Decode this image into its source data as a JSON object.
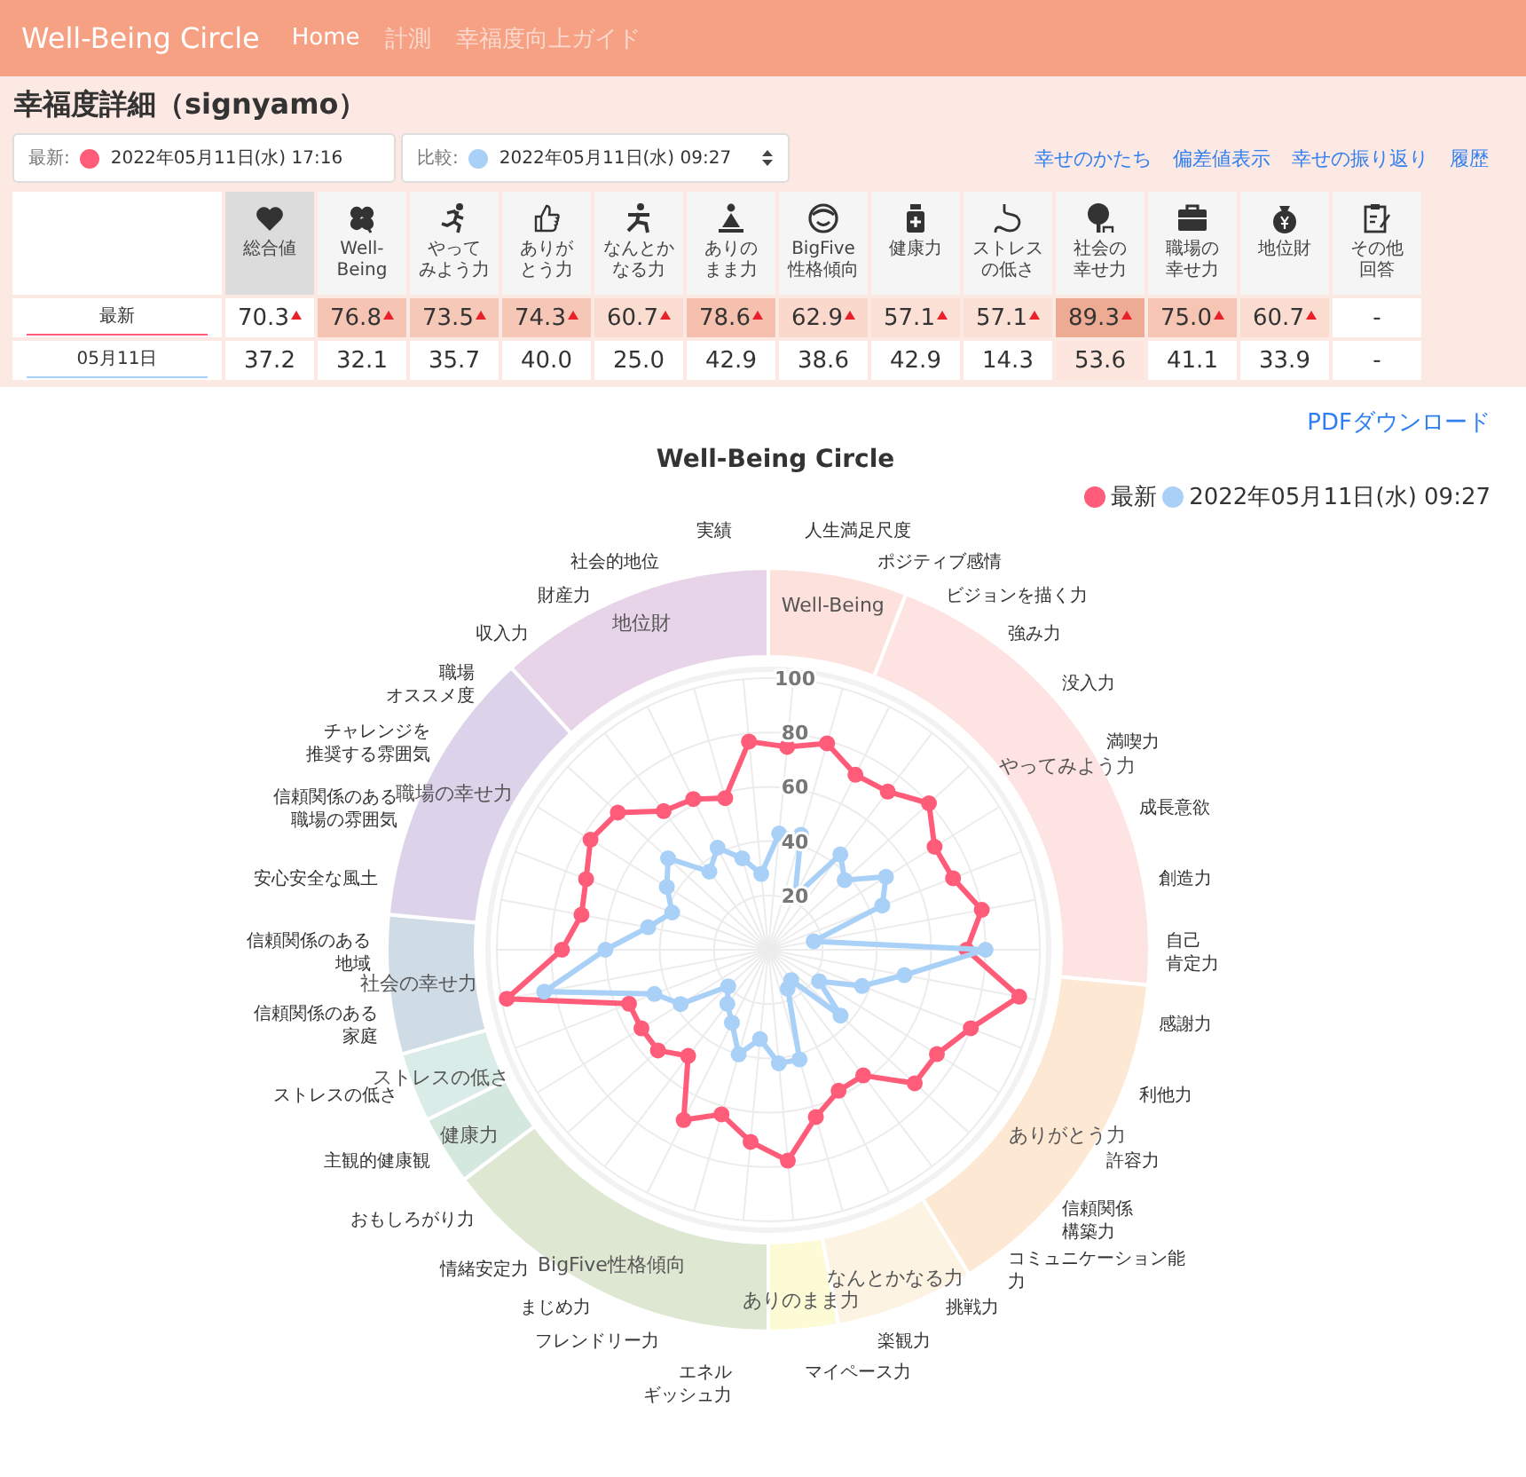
{
  "nav": {
    "brand": "Well-Being Circle",
    "items": [
      {
        "label": "Home",
        "selected": true
      },
      {
        "label": "計測",
        "selected": false
      },
      {
        "label": "幸福度向上ガイド",
        "selected": false
      }
    ]
  },
  "page_title": "幸福度詳細（signyamo）",
  "selectors": [
    {
      "kind": "static",
      "label": "最新:",
      "color": "#ff5c7a",
      "value": "2022年05月11日(水) 17:16"
    },
    {
      "kind": "select",
      "label": "比較:",
      "color": "#a9d0f7",
      "value": "2022年05月11日(水) 09:27"
    }
  ],
  "links": [
    "幸せのかたち",
    "偏差値表示",
    "幸せの振り返り",
    "履歴"
  ],
  "table": {
    "columns": [
      {
        "label": [
          "総合値"
        ],
        "selected": true
      },
      {
        "label": [
          "Well-",
          "Being"
        ],
        "selected": false
      },
      {
        "label": [
          "やって",
          "みよう力"
        ],
        "selected": false
      },
      {
        "label": [
          "ありが",
          "とう力"
        ],
        "selected": false
      },
      {
        "label": [
          "なんとか",
          "なる力"
        ],
        "selected": false
      },
      {
        "label": [
          "ありの",
          "まま力"
        ],
        "selected": false
      },
      {
        "label": [
          "BigFive",
          "性格傾向"
        ],
        "selected": false
      },
      {
        "label": [
          "健康力"
        ],
        "selected": false
      },
      {
        "label": [
          "ストレス",
          "の低さ"
        ],
        "selected": false
      },
      {
        "label": [
          "社会の",
          "幸せ力"
        ],
        "selected": false
      },
      {
        "label": [
          "職場の",
          "幸せ力"
        ],
        "selected": false
      },
      {
        "label": [
          "地位財"
        ],
        "selected": false
      },
      {
        "label": [
          "その他",
          "回答"
        ],
        "selected": false
      }
    ],
    "rows": [
      {
        "label": "最新",
        "color": "#ff5c7a",
        "cells": [
          {
            "value": "70.3",
            "up": true
          },
          {
            "value": "76.8",
            "up": true,
            "color": "#f6c4b3"
          },
          {
            "value": "73.5",
            "up": true,
            "color": "#f6c8b8"
          },
          {
            "value": "74.3",
            "up": true,
            "color": "#f6c6b6"
          },
          {
            "value": "60.7",
            "up": true,
            "color": "#fbdcd1"
          },
          {
            "value": "78.6",
            "up": true,
            "color": "#f5c0ae"
          },
          {
            "value": "62.9",
            "up": true,
            "color": "#fad8cb"
          },
          {
            "value": "57.1",
            "up": true,
            "color": "#fbe0d6"
          },
          {
            "value": "57.1",
            "up": true,
            "color": "#fbe0d6"
          },
          {
            "value": "89.3",
            "up": true,
            "color": "#eeab94"
          },
          {
            "value": "75.0",
            "up": true,
            "color": "#f6c5b4"
          },
          {
            "value": "60.7",
            "up": true,
            "color": "#fbdcd1"
          },
          {
            "value": "-",
            "up": false
          }
        ]
      },
      {
        "label": "05月11日",
        "color": "#a9d0f7",
        "cells": [
          {
            "value": "37.2",
            "up": false
          },
          {
            "value": "32.1",
            "up": false
          },
          {
            "value": "35.7",
            "up": false
          },
          {
            "value": "40.0",
            "up": false
          },
          {
            "value": "25.0",
            "up": false
          },
          {
            "value": "42.9",
            "up": false
          },
          {
            "value": "38.6",
            "up": false
          },
          {
            "value": "42.9",
            "up": false
          },
          {
            "value": "14.3",
            "up": false
          },
          {
            "value": "53.6",
            "up": false,
            "color": "#fde6de"
          },
          {
            "value": "41.1",
            "up": false
          },
          {
            "value": "33.9",
            "up": false
          },
          {
            "value": "-",
            "up": false
          }
        ]
      }
    ]
  },
  "radar": {
    "link": "PDFダウンロード",
    "title": "Well-Being Circle",
    "legend": [
      {
        "name": "最新",
        "color": "#ff5c7a"
      },
      {
        "name": "2022年05月11日(水) 09:27",
        "color": "#a9d0f7"
      }
    ],
    "ticks": [
      "100",
      "80",
      "60",
      "40",
      "20"
    ],
    "segments_right": [
      {
        "label": "Well-Being",
        "color": "#fde1dc",
        "axes": [
          [
            "人生満足尺度"
          ],
          [
            "ポジティブ感情"
          ]
        ]
      },
      {
        "label": "やってみよう力",
        "color": "#fde4e2",
        "axes": [
          [
            "ビジョンを描く力"
          ],
          [
            "強み力"
          ],
          [
            "没入力"
          ],
          [
            "満喫力"
          ],
          [
            "成長意欲"
          ],
          [
            "創造力"
          ],
          [
            "自己",
            "肯定力"
          ]
        ]
      },
      {
        "label": "ありがとう力",
        "color": "#fde8d3",
        "axes": [
          [
            "感謝力"
          ],
          [
            "利他力"
          ],
          [
            "許容力"
          ],
          [
            "信頼関係",
            "構築力"
          ],
          [
            "コミュニケーション能",
            "力"
          ]
        ]
      },
      {
        "label": "なんとかなる力",
        "color": "#fdf3e2",
        "axes": [
          [
            "挑戦力"
          ],
          [
            "楽観力"
          ]
        ]
      },
      {
        "label": "ありのまま力",
        "color": "#fdfad6",
        "axes": [
          [
            "マイペース力"
          ]
        ]
      }
    ],
    "segments_left": [
      {
        "label": "地位財",
        "color": "#e8d4e8",
        "axes": [
          [
            "実績"
          ],
          [
            "社会的地位"
          ],
          [
            "財産力"
          ],
          [
            "収入力"
          ]
        ]
      },
      {
        "label": "職場の幸せ力",
        "color": "#dcd3ea",
        "axes": [
          [
            "職場",
            "オススメ度"
          ],
          [
            "チャレンジを",
            "推奨する雰囲気"
          ],
          [
            "信頼関係のある",
            "職場の雰囲気"
          ],
          [
            "安心安全な風土"
          ]
        ]
      },
      {
        "label": "社会の幸せ力",
        "color": "#cfdce6",
        "axes": [
          [
            "信頼関係のある",
            "地域"
          ],
          [
            "信頼関係のある",
            "家庭"
          ]
        ]
      },
      {
        "label": "ストレスの低さ",
        "color": "#d9ece7",
        "axes": [
          [
            "ストレスの低さ"
          ]
        ]
      },
      {
        "label": "健康力",
        "color": "#d5e8de",
        "axes": [
          [
            "主観的健康観"
          ]
        ]
      },
      {
        "label": "BigFive性格傾向",
        "color": "#dde7d2",
        "axes": [
          [
            "おもしろがり力"
          ],
          [
            "情緒安定力"
          ],
          [
            "まじめ力"
          ],
          [
            "フレンドリー力"
          ],
          [
            "エネル",
            "ギッシュ力"
          ]
        ]
      }
    ]
  }
}
